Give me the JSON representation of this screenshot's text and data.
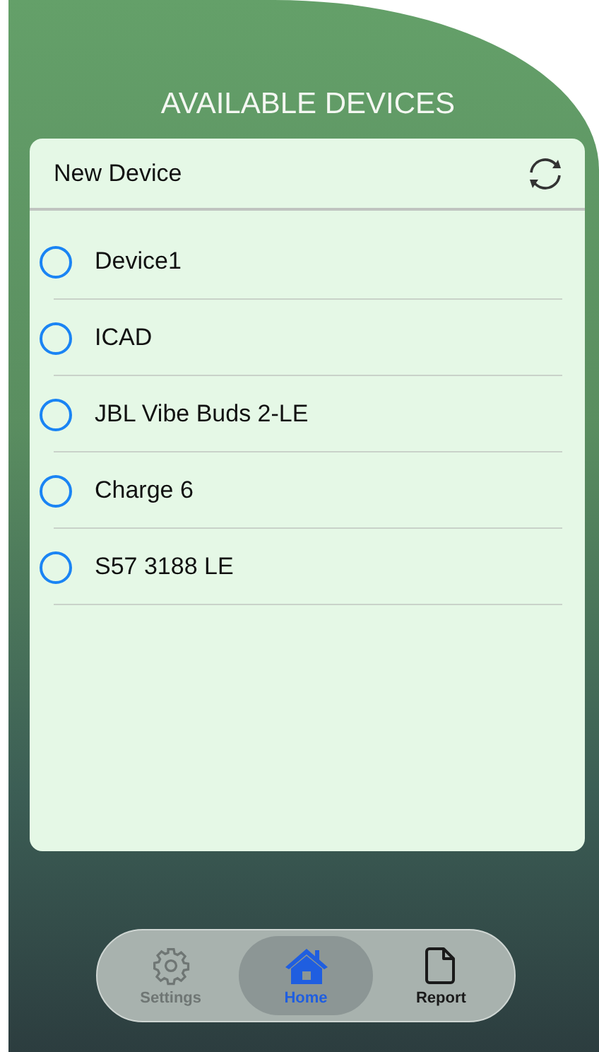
{
  "title": "AVAILABLE DEVICES",
  "list_header": {
    "label": "New Device"
  },
  "devices": [
    {
      "name": "Device1",
      "selected": false
    },
    {
      "name": "ICAD",
      "selected": false
    },
    {
      "name": "JBL Vibe Buds 2-LE",
      "selected": false
    },
    {
      "name": "Charge 6",
      "selected": false
    },
    {
      "name": "S57 3188 LE",
      "selected": false
    }
  ],
  "tab_bar": [
    {
      "kind": "settings",
      "label": "Settings",
      "selected": false,
      "disabled": true
    },
    {
      "kind": "home",
      "label": "Home",
      "selected": true,
      "disabled": false
    },
    {
      "kind": "report",
      "label": "Report",
      "selected": false,
      "disabled": false
    }
  ]
}
